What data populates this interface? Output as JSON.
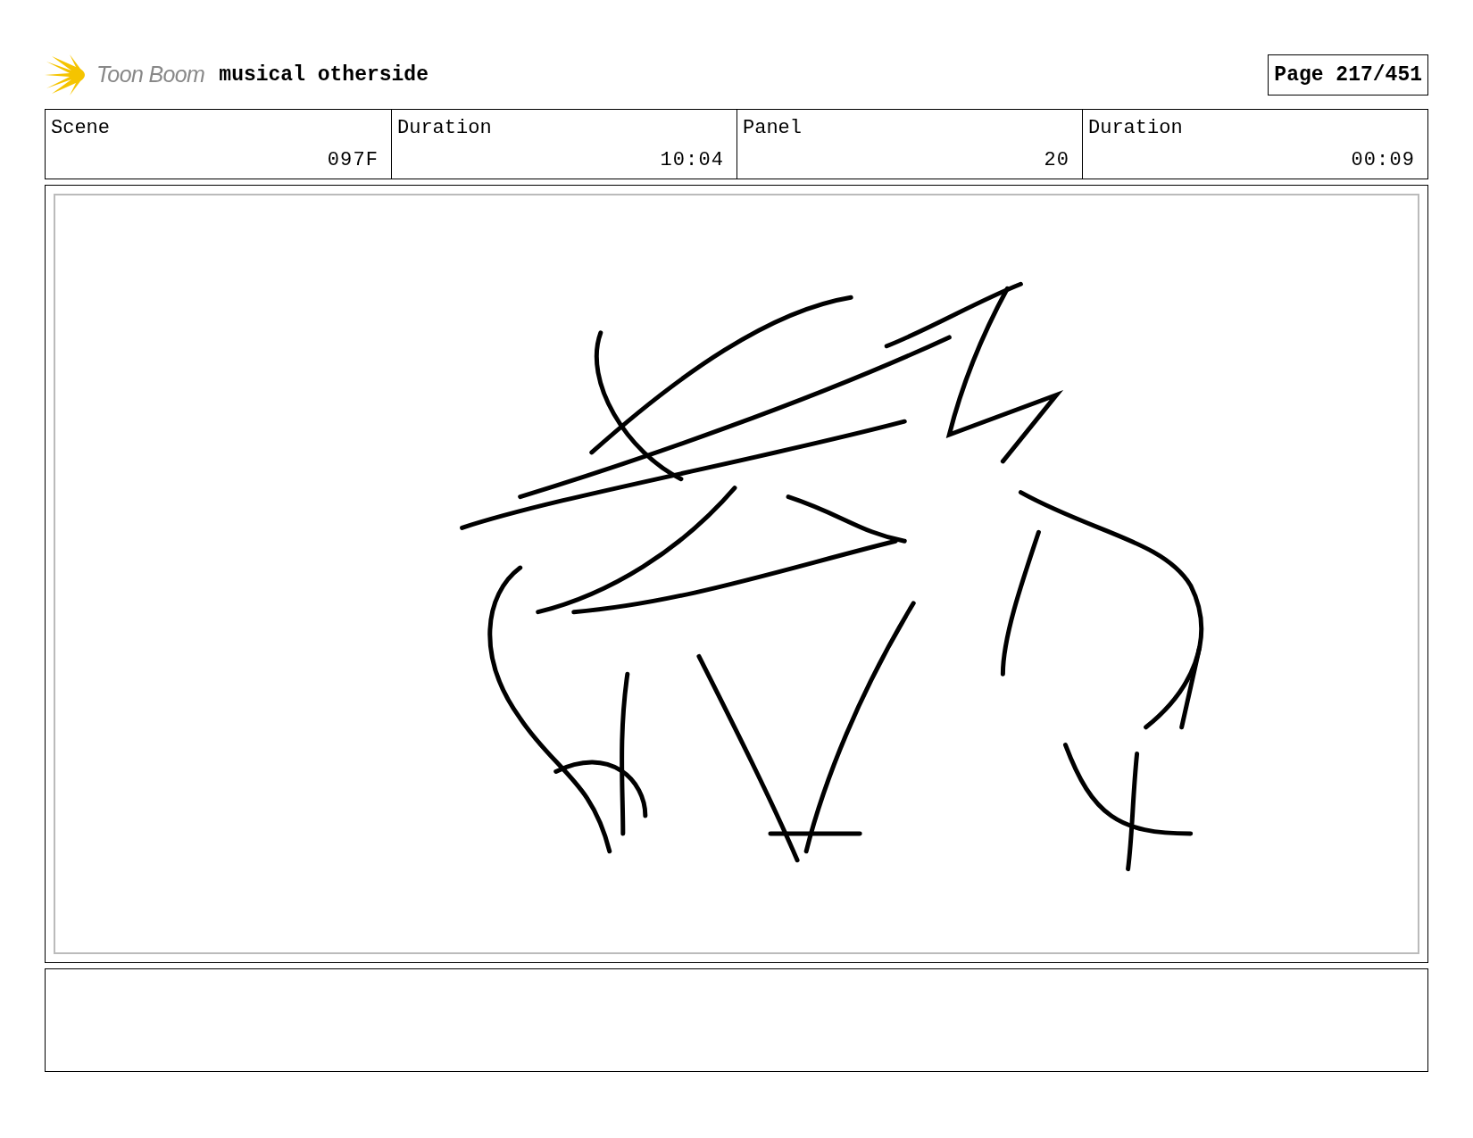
{
  "header": {
    "logo_text": "Toon Boom",
    "title": "musical otherside",
    "page": "Page 217/451"
  },
  "info": [
    {
      "label": "Scene",
      "value": "097F"
    },
    {
      "label": "Duration",
      "value": "10:04"
    },
    {
      "label": "Panel",
      "value": "20"
    },
    {
      "label": "Duration",
      "value": "00:09"
    }
  ]
}
